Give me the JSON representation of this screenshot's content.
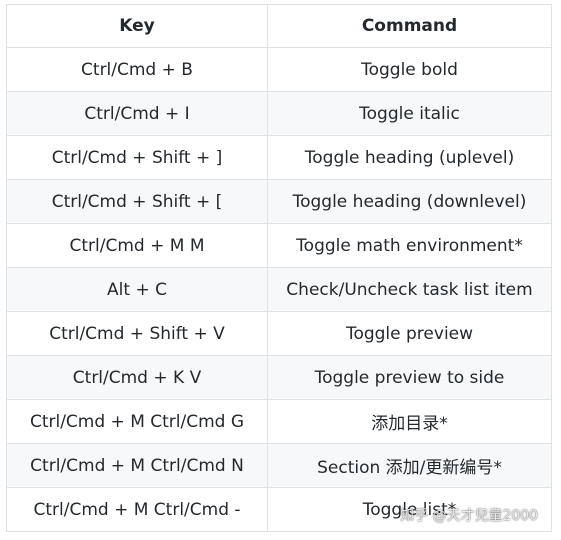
{
  "table": {
    "headers": [
      "Key",
      "Command"
    ],
    "rows": [
      [
        "Ctrl/Cmd + B",
        "Toggle bold"
      ],
      [
        "Ctrl/Cmd + I",
        "Toggle italic"
      ],
      [
        "Ctrl/Cmd + Shift + ]",
        "Toggle heading (uplevel)"
      ],
      [
        "Ctrl/Cmd + Shift + [",
        "Toggle heading (downlevel)"
      ],
      [
        "Ctrl/Cmd + M M",
        "Toggle math environment*"
      ],
      [
        "Alt + C",
        "Check/Uncheck task list item"
      ],
      [
        "Ctrl/Cmd + Shift + V",
        "Toggle preview"
      ],
      [
        "Ctrl/Cmd + K V",
        "Toggle preview to side"
      ],
      [
        "Ctrl/Cmd + M Ctrl/Cmd G",
        "添加目录*"
      ],
      [
        "Ctrl/Cmd + M Ctrl/Cmd N",
        "Section 添加/更新编号*"
      ],
      [
        "Ctrl/Cmd + M Ctrl/Cmd -",
        "Toggle list*"
      ]
    ]
  },
  "watermark": "知乎 @天才兒童2000"
}
